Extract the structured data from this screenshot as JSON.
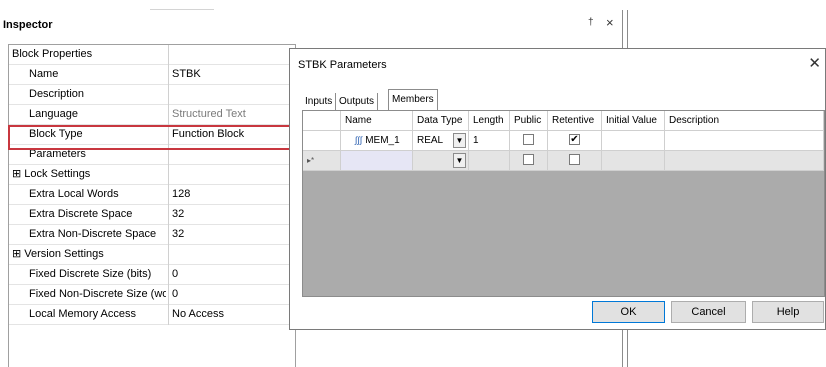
{
  "inspector": {
    "title": "Inspector",
    "pin_glyph": "̧†",
    "close_glyph": "×",
    "properties": [
      {
        "name": "Block Properties",
        "value": "",
        "kind": "header"
      },
      {
        "name": "Name",
        "value": "STBK"
      },
      {
        "name": "Description",
        "value": ""
      },
      {
        "name": "Language",
        "value": "Structured Text",
        "muted": true
      },
      {
        "name": "Block Type",
        "value": "Function Block",
        "highlighted": true
      },
      {
        "name": "Parameters",
        "value": ""
      },
      {
        "name": "⊞ Lock Settings",
        "value": "",
        "kind": "category"
      },
      {
        "name": "Extra Local Words",
        "value": "128"
      },
      {
        "name": "Extra Discrete Space",
        "value": "32"
      },
      {
        "name": "Extra Non-Discrete Space",
        "value": "32"
      },
      {
        "name": "⊞ Version Settings",
        "value": "",
        "kind": "category"
      },
      {
        "name": "Fixed Discrete Size (bits)",
        "value": "0"
      },
      {
        "name": "Fixed Non-Discrete Size (words",
        "value": "0"
      },
      {
        "name": "Local Memory Access",
        "value": "No Access"
      }
    ]
  },
  "dialog": {
    "title": "STBK Parameters",
    "close_glyph": "✕",
    "tabs": [
      "Inputs",
      "Outputs",
      "Members"
    ],
    "active_tab": "Members",
    "columns": [
      "Name",
      "Data Type",
      "Length",
      "Public",
      "Retentive",
      "Initial Value",
      "Description"
    ],
    "rows": [
      {
        "icon": "∫∫∫",
        "name": "MEM_1",
        "data_type": "REAL",
        "length": "1",
        "public": false,
        "retentive": true,
        "initial_value": "",
        "description": ""
      }
    ],
    "new_row_marker": "▸*",
    "dropdown_glyph": "▼",
    "check_glyph": "✔",
    "buttons": {
      "ok": "OK",
      "cancel": "Cancel",
      "help": "Help"
    }
  }
}
